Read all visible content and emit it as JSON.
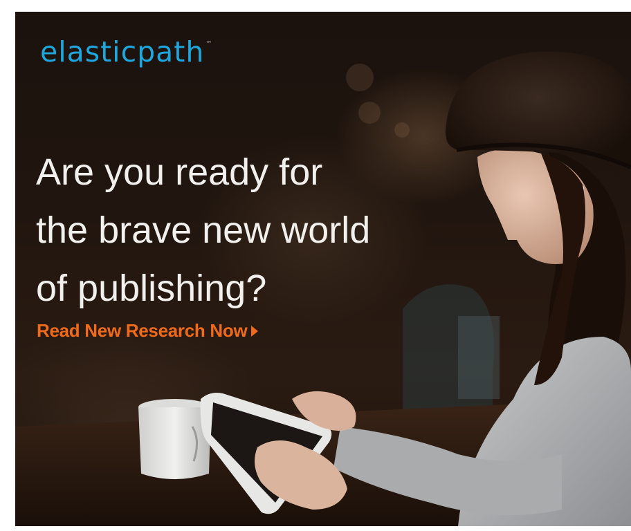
{
  "ad": {
    "logo_text": "elasticpath",
    "logo_tm": "™",
    "headline_line1": "Are you ready for",
    "headline_line2": "the brave new world",
    "headline_line3": "of publishing?",
    "cta_label": "Read New Research Now",
    "cta_icon": "play-arrow-icon",
    "colors": {
      "logo": "#1fa6dd",
      "cta": "#ee6b1e",
      "headline": "#f2f0ed",
      "background": "#1f150f"
    }
  }
}
